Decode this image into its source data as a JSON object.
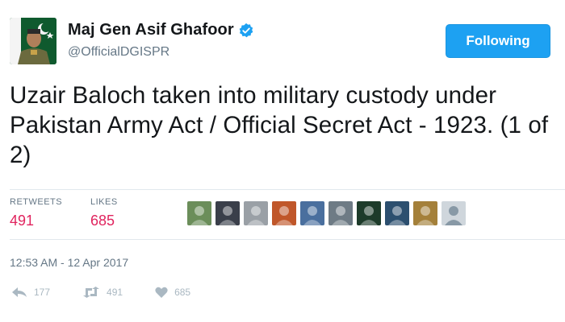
{
  "user": {
    "display_name": "Maj Gen Asif Ghafoor",
    "handle": "@OfficialDGISPR",
    "verified_icon": "verified-badge-icon",
    "avatar_icon": "profile-avatar"
  },
  "follow_button": {
    "label": "Following"
  },
  "tweet": {
    "text": "Uzair Baloch taken into military custody under Pakistan Army Act / Official Secret Act - 1923. (1 of 2)"
  },
  "stats": {
    "retweets_label": "RETWEETS",
    "retweets_value": "491",
    "likes_label": "LIKES",
    "likes_value": "685"
  },
  "likers": [
    {
      "icon": "liker-avatar-1",
      "color": "#6b8e5a"
    },
    {
      "icon": "liker-avatar-2",
      "color": "#3a3f4a"
    },
    {
      "icon": "liker-avatar-3",
      "color": "#9aa0a6"
    },
    {
      "icon": "liker-avatar-4",
      "color": "#c0572a"
    },
    {
      "icon": "liker-avatar-5",
      "color": "#4a6f9e"
    },
    {
      "icon": "liker-avatar-6",
      "color": "#6e7b85"
    },
    {
      "icon": "liker-avatar-7",
      "color": "#1d3b2a"
    },
    {
      "icon": "liker-avatar-8",
      "color": "#2c4f6f"
    },
    {
      "icon": "liker-avatar-9",
      "color": "#a4803a"
    },
    {
      "icon": "liker-avatar-10",
      "color": "#cfd6dc"
    }
  ],
  "timestamp": "12:53 AM - 12 Apr 2017",
  "actions": {
    "reply_count": "177",
    "retweet_count": "491",
    "like_count": "685"
  },
  "colors": {
    "accent": "#1da1f2",
    "like_red": "#e0245e",
    "muted": "#657786"
  }
}
